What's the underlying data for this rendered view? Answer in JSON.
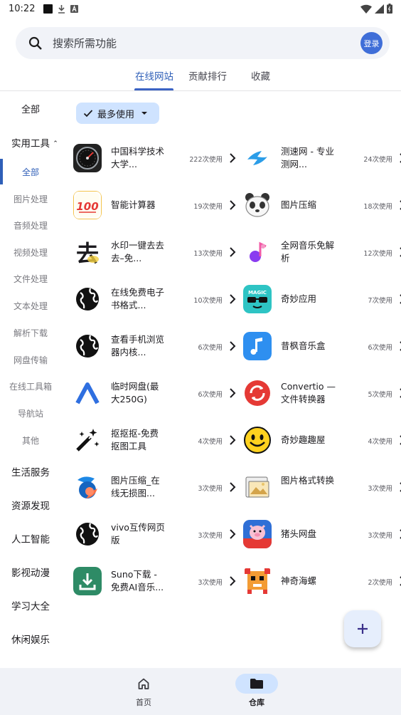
{
  "status_bar": {
    "time": "10:22"
  },
  "search": {
    "placeholder": "搜索所需功能",
    "login_label": "登录"
  },
  "tabs": [
    {
      "label": "在线网站",
      "active": true
    },
    {
      "label": "贡献排行",
      "active": false
    },
    {
      "label": "收藏",
      "active": false
    }
  ],
  "sidebar": {
    "all": "全部",
    "category_tools": "实用工具",
    "sub_items": [
      "全部",
      "图片处理",
      "音频处理",
      "视频处理",
      "文件处理",
      "文本处理",
      "解析下载",
      "网盘传输",
      "在线工具箱",
      "导航站",
      "其他"
    ],
    "categories": [
      "生活服务",
      "资源发现",
      "人工智能",
      "影视动漫",
      "学习大全",
      "休闲娱乐"
    ]
  },
  "filter": {
    "label": "最多使用"
  },
  "items": [
    {
      "name": "中国科学技术大学...",
      "usage": "222次使用",
      "icon": "speedometer-icon"
    },
    {
      "name": "测速网 - 专业测网...",
      "usage": "24次使用",
      "icon": "speedtest-icon"
    },
    {
      "name": "智能计算器",
      "usage": "19次使用",
      "icon": "calculator-icon"
    },
    {
      "name": "图片压缩",
      "usage": "18次使用",
      "icon": "panda-icon"
    },
    {
      "name": "水印一键去去去–免...",
      "usage": "13次使用",
      "icon": "watermark-icon"
    },
    {
      "name": "全网音乐免解析",
      "usage": "12次使用",
      "icon": "music-note-icon"
    },
    {
      "name": "在线免费电子书格式...",
      "usage": "10次使用",
      "icon": "globe-icon"
    },
    {
      "name": "奇妙应用",
      "usage": "7次使用",
      "icon": "magic-icon"
    },
    {
      "name": "查看手机浏览器内核...",
      "usage": "6次使用",
      "icon": "globe-icon"
    },
    {
      "name": "昔枫音乐盒",
      "usage": "6次使用",
      "icon": "music-box-icon"
    },
    {
      "name": "临时网盘(最大250G)",
      "usage": "6次使用",
      "icon": "chevron-up-logo-icon"
    },
    {
      "name": "Convertio — 文件转换器",
      "usage": "5次使用",
      "icon": "convert-icon"
    },
    {
      "name": "抠抠抠-免费抠图工具",
      "usage": "4次使用",
      "icon": "magic-wand-icon"
    },
    {
      "name": "奇妙趣趣屋",
      "usage": "4次使用",
      "icon": "smiley-icon"
    },
    {
      "name": "图片压缩_在线无损图...",
      "usage": "3次使用",
      "icon": "compress-logo-icon"
    },
    {
      "name": "图片格式转换",
      "usage": "3次使用",
      "icon": "photo-icon"
    },
    {
      "name": "vivo互传网页版",
      "usage": "3次使用",
      "icon": "globe-icon"
    },
    {
      "name": "猪头网盘",
      "usage": "3次使用",
      "icon": "pig-icon"
    },
    {
      "name": "Suno下载 - 免费AI音乐...",
      "usage": "3次使用",
      "icon": "download-icon"
    },
    {
      "name": "神奇海螺",
      "usage": "2次使用",
      "icon": "pixel-creature-icon"
    }
  ],
  "bottom_nav": [
    {
      "label": "首页",
      "icon": "home-icon",
      "active": false
    },
    {
      "label": "仓库",
      "icon": "folder-icon",
      "active": true
    }
  ],
  "colors": {
    "accent": "#2f5fb8",
    "chip": "#cfe3ff",
    "login": "#3f6ed8"
  }
}
